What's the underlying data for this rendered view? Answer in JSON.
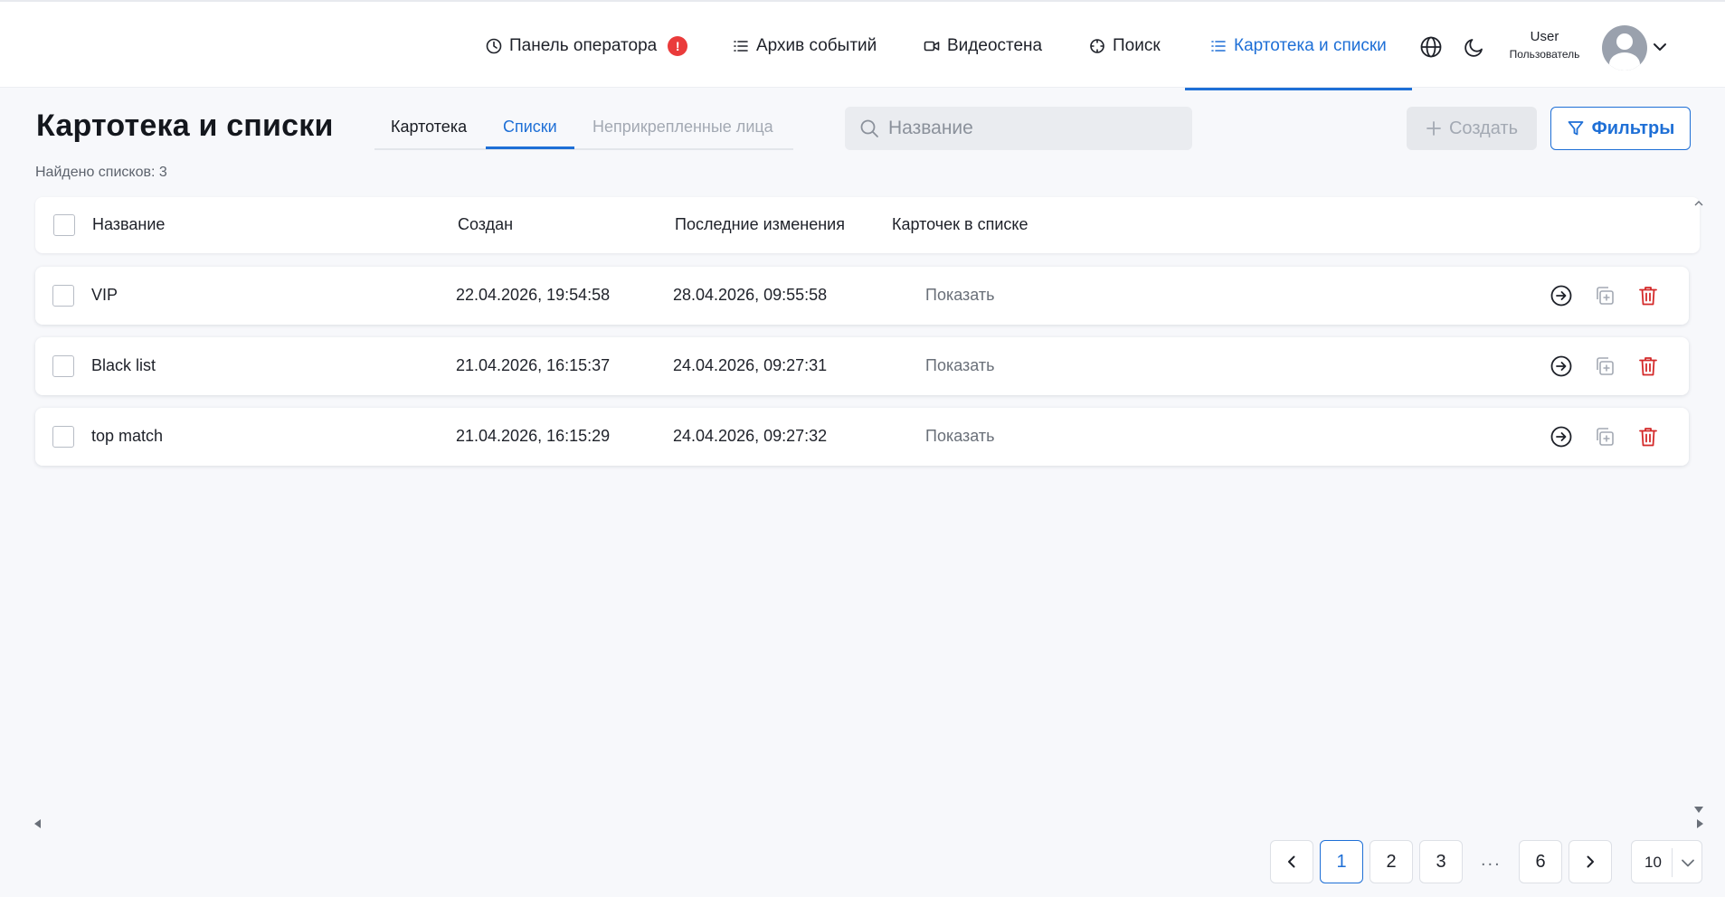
{
  "nav": {
    "items": [
      {
        "label": "Панель оператора",
        "icon": "clock-icon",
        "badge": "!"
      },
      {
        "label": "Архив событий",
        "icon": "list-icon"
      },
      {
        "label": "Видеостена",
        "icon": "video-camera-icon"
      },
      {
        "label": "Поиск",
        "icon": "crosshair-icon"
      },
      {
        "label": "Картотека и списки",
        "icon": "list-icon",
        "active": true
      }
    ],
    "language_icon": "globe-icon",
    "theme_icon": "moon-icon"
  },
  "user": {
    "name": "User",
    "role": "Пользователь"
  },
  "page": {
    "title": "Картотека и списки",
    "tabs": [
      {
        "label": "Картотека"
      },
      {
        "label": "Списки",
        "active": true
      },
      {
        "label": "Неприкрепленные лица",
        "disabled": true
      }
    ],
    "search_placeholder": "Название",
    "create_label": "Создать",
    "filter_label": "Фильтры",
    "found_text": "Найдено списков: 3"
  },
  "table": {
    "columns": [
      "Название",
      "Создан",
      "Последние изменения",
      "Карточек в списке"
    ],
    "rows": [
      {
        "name": "VIP",
        "created": "22.04.2026, 19:54:58",
        "modified": "28.04.2026, 09:55:58",
        "cards": "Показать"
      },
      {
        "name": "Black list",
        "created": "21.04.2026, 16:15:37",
        "modified": "24.04.2026, 09:27:31",
        "cards": "Показать"
      },
      {
        "name": "top match",
        "created": "21.04.2026, 16:15:29",
        "modified": "24.04.2026, 09:27:32",
        "cards": "Показать"
      }
    ]
  },
  "pagination": {
    "pages": [
      "1",
      "2",
      "3"
    ],
    "ellipsis": "...",
    "last_page": "6",
    "current": "1",
    "per_page": "10"
  },
  "colors": {
    "accent": "#1e6fd6",
    "danger": "#d42a2a",
    "badge": "#ea3b3b"
  }
}
